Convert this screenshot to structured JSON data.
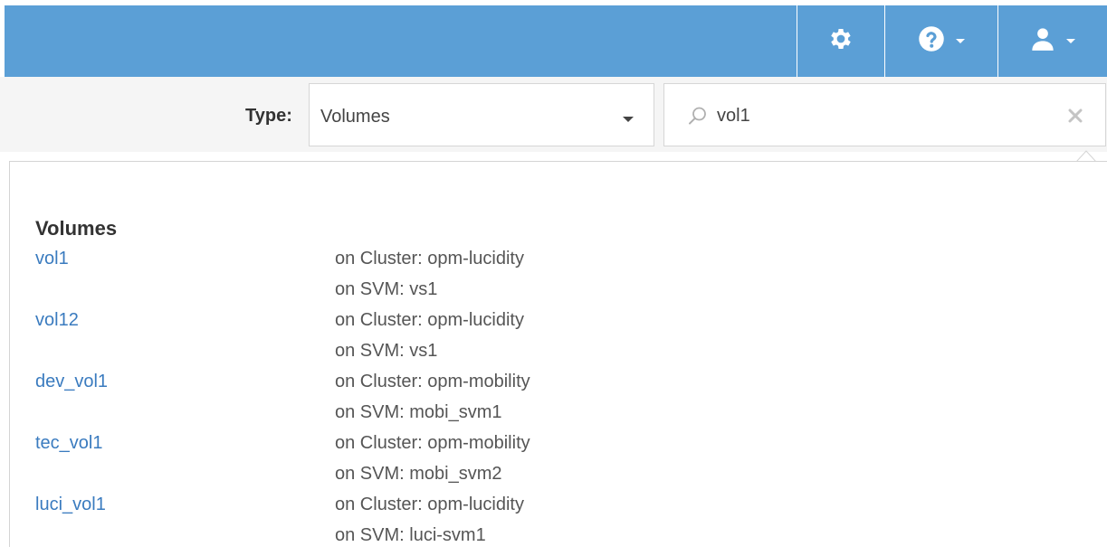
{
  "header": {
    "settings_icon": "gear-icon",
    "help_icon": "question-circle-icon",
    "user_icon": "user-icon",
    "bar_color": "#5b9fd6"
  },
  "filter": {
    "type_label": "Type:",
    "type_value": "Volumes",
    "search_value": "vol1",
    "search_icon": "search-icon",
    "clear_icon": "close-icon"
  },
  "results": {
    "section_title": "Volumes",
    "link_color": "#3a7bbf",
    "items": [
      {
        "name": "vol1",
        "cluster": "on Cluster: opm-lucidity",
        "svm": "on SVM: vs1"
      },
      {
        "name": "vol12",
        "cluster": "on Cluster: opm-lucidity",
        "svm": "on SVM: vs1"
      },
      {
        "name": "dev_vol1",
        "cluster": "on Cluster: opm-mobility",
        "svm": "on SVM: mobi_svm1"
      },
      {
        "name": "tec_vol1",
        "cluster": "on Cluster: opm-mobility",
        "svm": "on SVM: mobi_svm2"
      },
      {
        "name": "luci_vol1",
        "cluster": "on Cluster: opm-lucidity",
        "svm": "on SVM: luci-svm1"
      }
    ]
  }
}
